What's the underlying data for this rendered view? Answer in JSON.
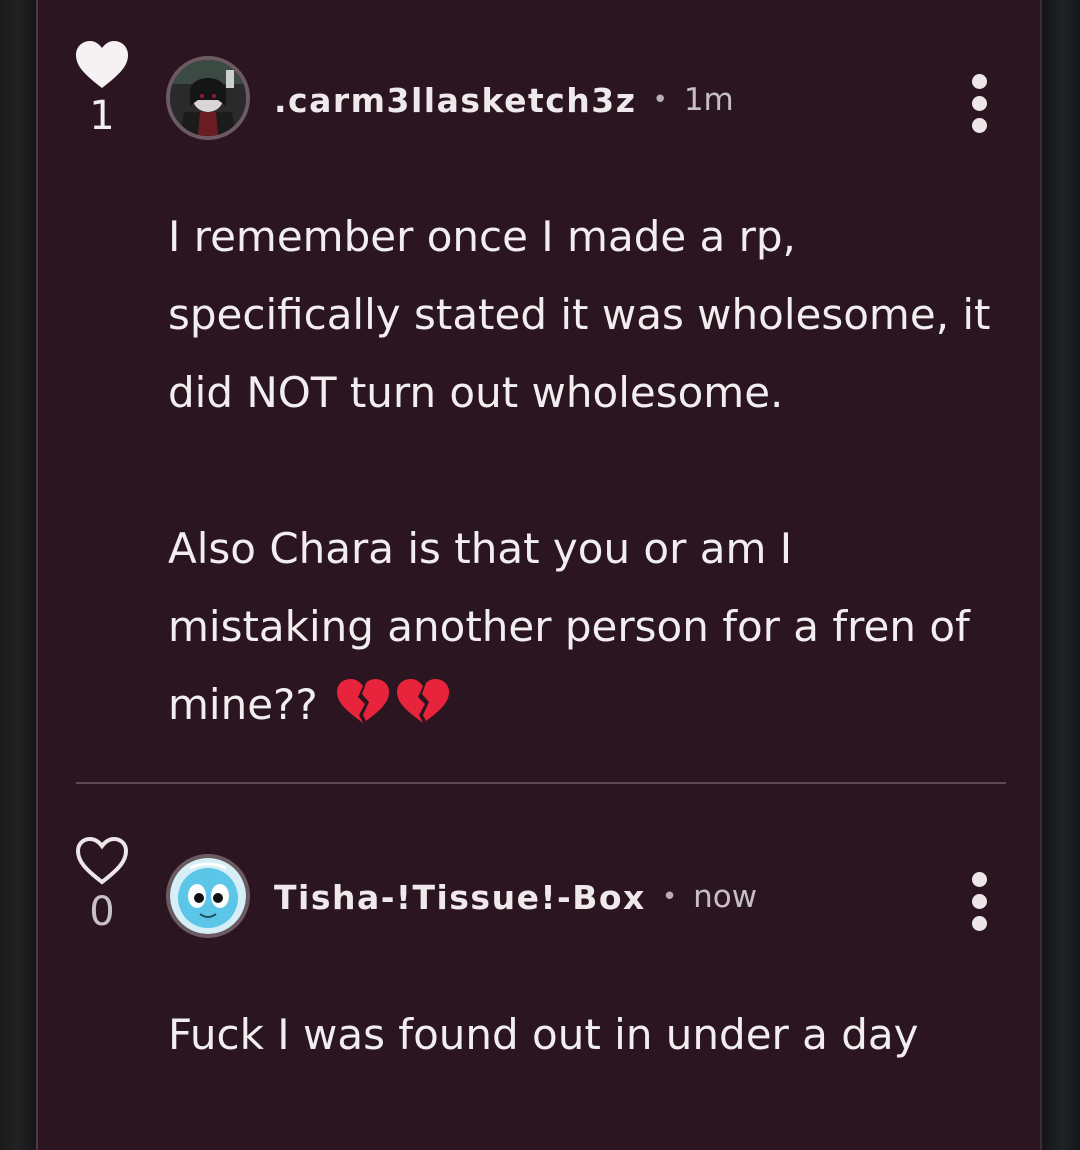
{
  "comments": [
    {
      "likes": "1",
      "liked": true,
      "username": ".carm3llasketch3z",
      "separator": "•",
      "time": "1m",
      "text": "I remember once I made a rp,\nspecifically stated it was wholesome, it\ndid NOT turn out wholesome.\n\nAlso Chara is that you or am I\nmistaking another person for a fren of\nmine?? ",
      "emojis": [
        "broken-heart",
        "broken-heart"
      ]
    },
    {
      "likes": "0",
      "liked": false,
      "username": "Tisha-!Tissue!-Box",
      "separator": "•",
      "time": "now",
      "text": "Fuck I was found out in under a day"
    }
  ],
  "colors": {
    "panel": "#2b1520",
    "text": "#f2eef0",
    "broken_heart": "#e8243c"
  },
  "icons": [
    "heart-filled-icon",
    "heart-outline-icon",
    "more-vertical-icon",
    "broken-heart-emoji"
  ]
}
